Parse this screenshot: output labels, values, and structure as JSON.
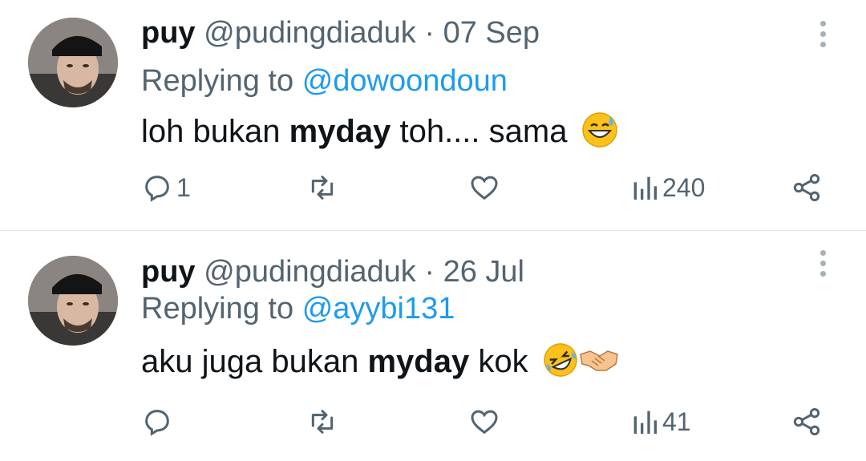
{
  "tweets": [
    {
      "name": "puy",
      "handle": "@pudingdiaduk",
      "separator": "·",
      "date": "07 Sep",
      "reply_prefix": "Replying to",
      "reply_to": "@dowoondoun",
      "text_before": "loh bukan ",
      "text_bold": "myday",
      "text_after": " toh.... sama",
      "emojis": [
        "sweat-smile-emoji"
      ],
      "replies": "1",
      "retweets": "",
      "likes": "",
      "views": "240"
    },
    {
      "name": "puy",
      "handle": "@pudingdiaduk",
      "separator": "·",
      "date": "26 Jul",
      "reply_prefix": "Replying to",
      "reply_to": "@ayybi131",
      "text_before": "aku juga bukan ",
      "text_bold": "myday",
      "text_after": " kok",
      "emojis": [
        "rolling-laughing-emoji",
        "handshake-emoji"
      ],
      "replies": "",
      "retweets": "",
      "likes": "",
      "views": "41"
    }
  ],
  "colors": {
    "accent": "#1d9bf0",
    "muted": "#536471",
    "text": "#0f1419"
  }
}
